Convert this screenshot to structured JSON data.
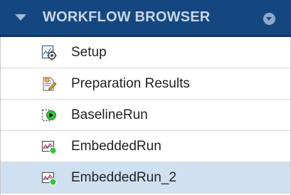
{
  "header": {
    "title": "WORKFLOW BROWSER",
    "collapse_icon": "triangle-down-icon",
    "menu_icon": "circle-chevron-down-icon",
    "color": "#14477f"
  },
  "items": [
    {
      "label": "Setup",
      "icon": "setup-icon",
      "selected": false
    },
    {
      "label": "Preparation Results",
      "icon": "preparation-results-icon",
      "selected": false
    },
    {
      "label": "BaselineRun",
      "icon": "baseline-run-icon",
      "selected": false
    },
    {
      "label": "EmbeddedRun",
      "icon": "embedded-run-icon",
      "selected": false
    },
    {
      "label": "EmbeddedRun_2",
      "icon": "embedded-run-icon",
      "selected": true
    }
  ],
  "colors": {
    "selected_row": "#cfe0f1",
    "status_green": "#3fbf3f"
  }
}
